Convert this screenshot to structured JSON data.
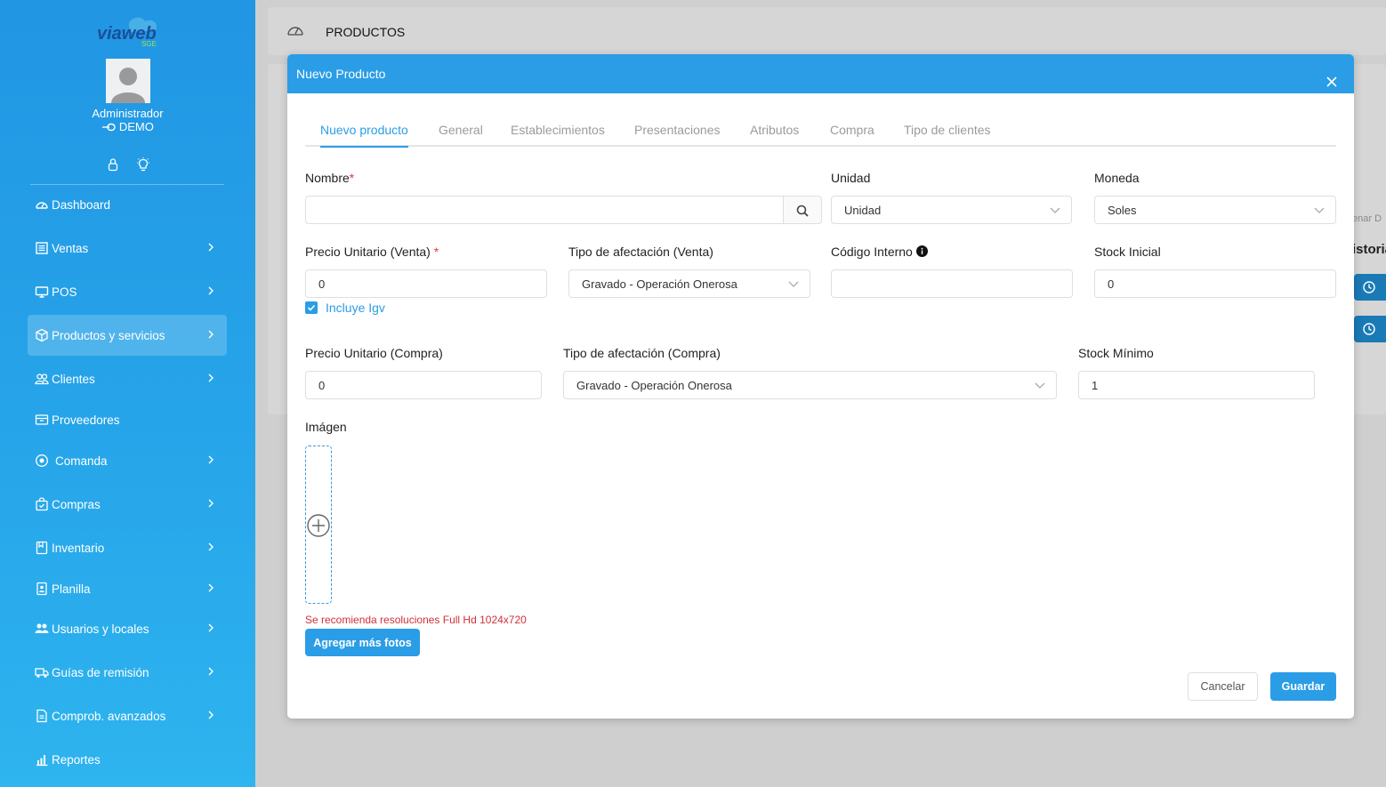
{
  "sidebar": {
    "logo_text": "viaweb",
    "logo_sub": "SGE",
    "user_name": "Administrador",
    "user_company": "DEMO",
    "menu": [
      {
        "label": "Dashboard",
        "icon": "dashboard-icon"
      },
      {
        "label": "Ventas",
        "icon": "ventas-icon"
      },
      {
        "label": "POS",
        "icon": "monitor-icon"
      },
      {
        "label": "Productos y servicios",
        "icon": "box-icon"
      },
      {
        "label": "Clientes",
        "icon": "users-icon"
      },
      {
        "label": "Proveedores",
        "icon": "truck-box-icon"
      },
      {
        "label": "Comanda",
        "icon": "comanda-icon"
      },
      {
        "label": "Compras",
        "icon": "bag-icon"
      },
      {
        "label": "Inventario",
        "icon": "inventory-icon"
      },
      {
        "label": "Planilla",
        "icon": "planilla-icon"
      },
      {
        "label": "Usuarios y locales",
        "icon": "user-group-icon"
      },
      {
        "label": "Guías de remisión",
        "icon": "truck-icon"
      },
      {
        "label": "Comprob. avanzados",
        "icon": "document-icon"
      },
      {
        "label": "Reportes",
        "icon": "chart-icon"
      }
    ]
  },
  "page": {
    "title": "PRODUCTOS",
    "bg_text1": "enar D",
    "bg_text2": "istoria"
  },
  "modal": {
    "title": "Nuevo Producto",
    "tabs": [
      "Nuevo producto",
      "General",
      "Establecimientos",
      "Presentaciones",
      "Atributos",
      "Compra",
      "Tipo de clientes"
    ],
    "fields": {
      "nombre_label": "Nombre",
      "nombre_value": "",
      "unidad_label": "Unidad",
      "unidad_value": "Unidad",
      "moneda_label": "Moneda",
      "moneda_value": "Soles",
      "precio_venta_label": "Precio Unitario (Venta)",
      "precio_venta_value": "0",
      "afectacion_venta_label": "Tipo de afectación (Venta)",
      "afectacion_venta_value": "Gravado - Operación Onerosa",
      "codigo_label": "Código Interno",
      "codigo_value": "",
      "stock_inicial_label": "Stock Inicial",
      "stock_inicial_value": "0",
      "incluye_igv_label": "Incluye Igv",
      "precio_compra_label": "Precio Unitario (Compra)",
      "precio_compra_value": "0",
      "afectacion_compra_label": "Tipo de afectación (Compra)",
      "afectacion_compra_value": "Gravado - Operación Onerosa",
      "stock_minimo_label": "Stock Mínimo",
      "stock_minimo_value": "1",
      "imagen_label": "Imágen",
      "imagen_hint": "Se recomienda resoluciones Full Hd 1024x720"
    },
    "buttons": {
      "add_photos": "Agregar más fotos",
      "cancel": "Cancelar",
      "save": "Guardar"
    }
  },
  "colors": {
    "accent": "#2a9de6",
    "sidebar_top": "#2196e3",
    "sidebar_bottom": "#2eb4ef",
    "hint_red": "#d0303a"
  }
}
